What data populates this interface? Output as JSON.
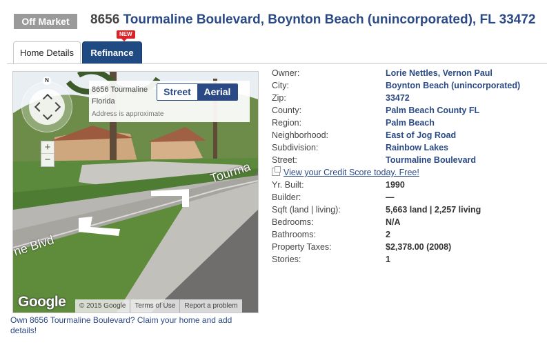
{
  "header": {
    "status_badge": "Off Market",
    "number": "8656",
    "address": "Tourmaline Boulevard, Boynton Beach (unincorporated), FL 33472"
  },
  "tabs": [
    {
      "label": "Home Details",
      "active": true
    },
    {
      "label": "Refinance",
      "active": false,
      "tag": "NEW"
    }
  ],
  "map": {
    "compass": "N",
    "zoom_in": "+",
    "zoom_out": "−",
    "info_line1": "8656 Tourmaline",
    "info_line2": "Florida",
    "info_approx": "Address is approximate",
    "street_btn": "Street",
    "aerial_btn": "Aerial",
    "logo": "Google",
    "attribution": [
      "© 2015 Google",
      "Terms of Use",
      "Report a problem"
    ],
    "street_label_right": "Tourma",
    "street_label_left": "ne Blvd"
  },
  "claim_text": "Own 8656 Tourmaline Boulevard? Claim your home and add details!",
  "details": [
    {
      "label": "Owner:",
      "value": "Lorie Nettles, Vernon Paul",
      "link": true
    },
    {
      "label": "City:",
      "value": "Boynton Beach (unincorporated)",
      "link": true
    },
    {
      "label": "Zip:",
      "value": "33472",
      "link": true
    },
    {
      "label": "County:",
      "value": "Palm Beach County FL",
      "link": true
    },
    {
      "label": "Region:",
      "value": "Palm Beach",
      "link": true
    },
    {
      "label": "Neighborhood:",
      "value": "East of Jog Road",
      "link": true
    },
    {
      "label": "Subdivision:",
      "value": "Rainbow Lakes",
      "link": true
    },
    {
      "label": "Street:",
      "value": "Tourmaline Boulevard",
      "link": true
    }
  ],
  "credit_link": "View your Credit Score today. Free!",
  "details2": [
    {
      "label": "Yr. Built:",
      "value": "1990"
    },
    {
      "label": "Builder:",
      "value": "—"
    },
    {
      "label": "Sqft (land | living):",
      "value": "5,663 land | 2,257 living"
    },
    {
      "label": "Bedrooms:",
      "value": "N/A"
    },
    {
      "label": "Bathrooms:",
      "value": "2"
    },
    {
      "label": "Property Taxes:",
      "value": "$2,378.00 (2008)"
    },
    {
      "label": "Stories:",
      "value": "1"
    }
  ],
  "colors": {
    "brand": "#2b4a85",
    "badge": "#9a9a9a",
    "new_tag": "#d8222a",
    "tab_active_bg": "#1f4a82"
  }
}
